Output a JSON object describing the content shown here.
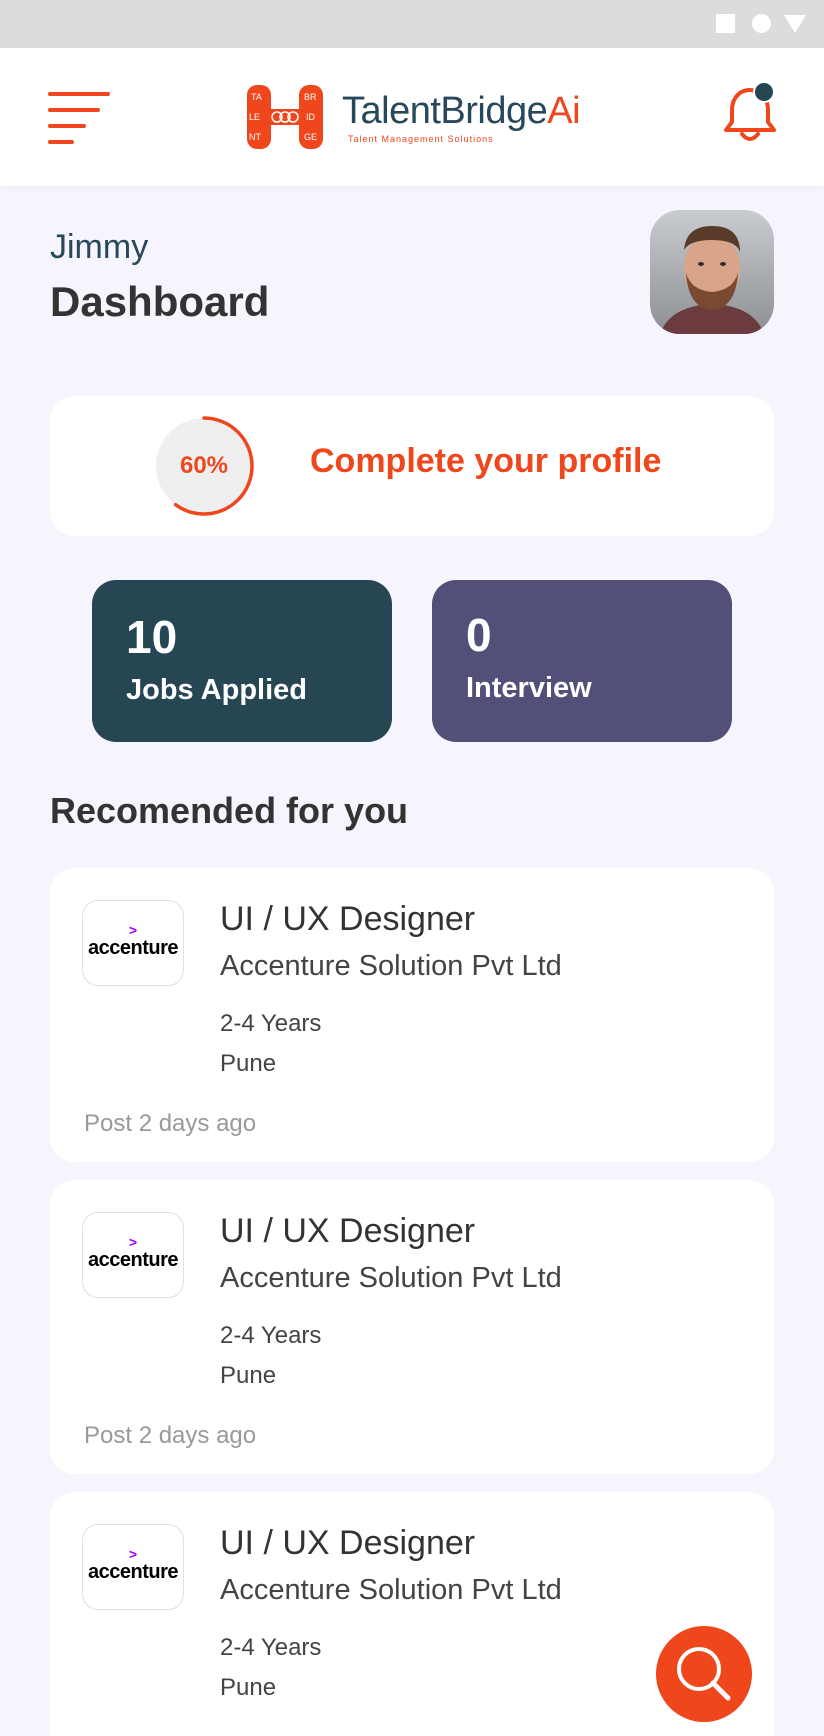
{
  "app": {
    "logo_text_main": "TalentBridge",
    "logo_text_accent": "Ai",
    "logo_tagline": "Talent Management Solutions",
    "accent_color": "#f0461c",
    "primary_dark": "#264653"
  },
  "header": {
    "menu_icon": "hamburger-menu-icon",
    "notification_icon": "bell-icon",
    "has_unread_notification": true
  },
  "user": {
    "name": "Jimmy",
    "page_title": "Dashboard"
  },
  "profile": {
    "completion_value": 0.6,
    "completion_text": "60%",
    "cta": "Complete your profile"
  },
  "stats": {
    "jobs_applied": {
      "count": "10",
      "label": "Jobs Applied",
      "color": "#264653"
    },
    "interview": {
      "count": "0",
      "label": "Interview",
      "color": "#525078"
    }
  },
  "recommended": {
    "title": "Recomended for you",
    "jobs": [
      {
        "logo": "accenture",
        "title": "UI / UX Designer",
        "company": "Accenture Solution Pvt Ltd",
        "experience": "2-4 Years",
        "location": "Pune",
        "posted": "Post 2 days ago"
      },
      {
        "logo": "accenture",
        "title": "UI / UX Designer",
        "company": "Accenture Solution Pvt Ltd",
        "experience": "2-4 Years",
        "location": "Pune",
        "posted": "Post 2 days ago"
      },
      {
        "logo": "accenture",
        "title": "UI / UX Designer",
        "company": "Accenture Solution Pvt Ltd",
        "experience": "2-4 Years",
        "location": "Pune",
        "posted": ""
      }
    ]
  },
  "fab": {
    "icon": "search-icon"
  }
}
